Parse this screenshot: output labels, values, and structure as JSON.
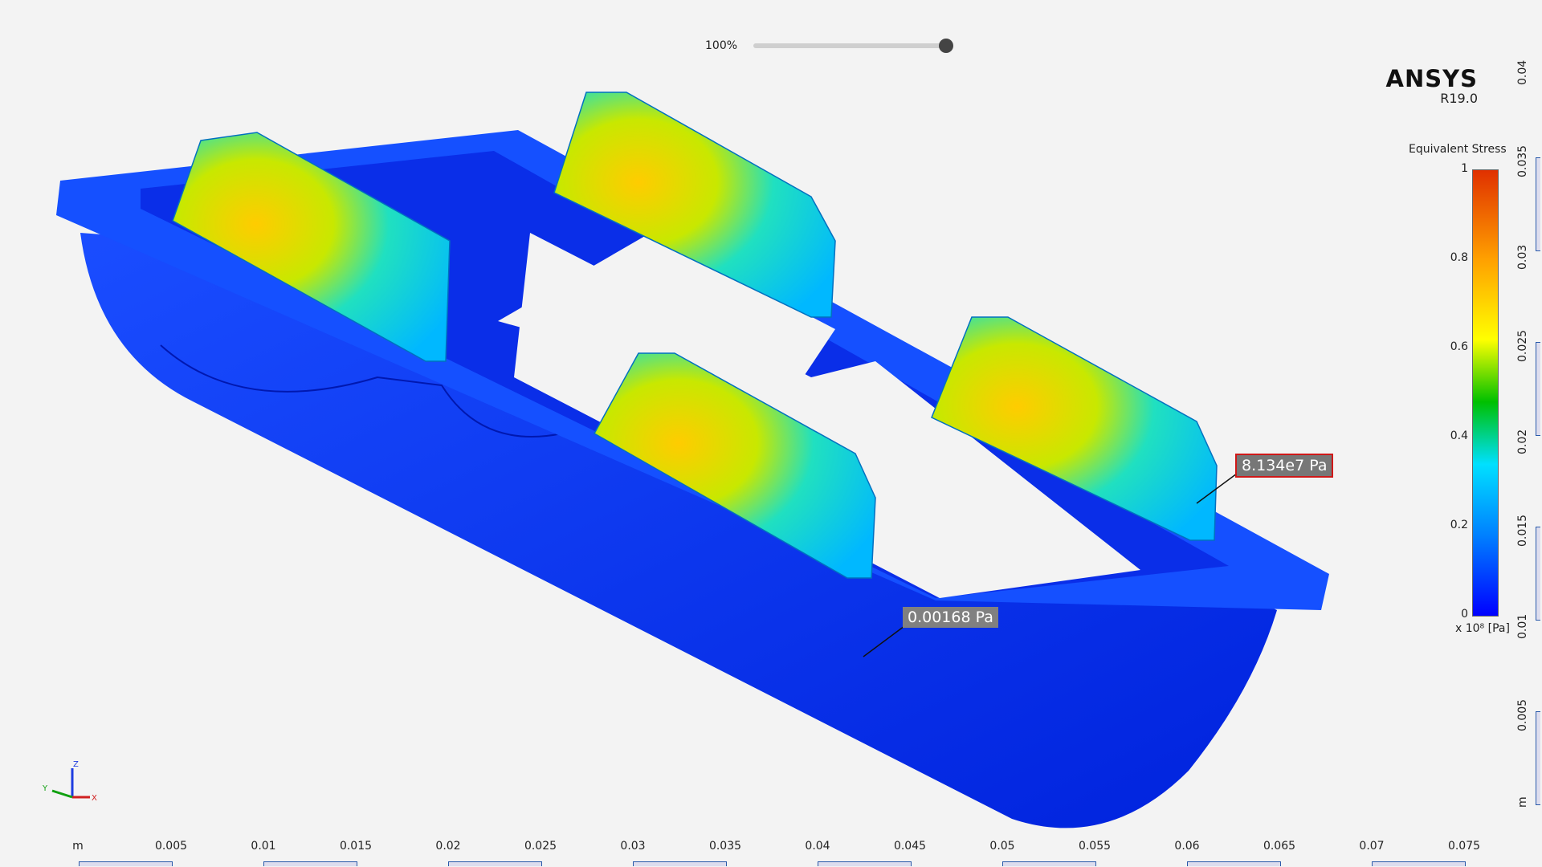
{
  "zoom": {
    "label": "100%",
    "value_percent": 100
  },
  "logo": {
    "brand": "ANSYS",
    "version": "R19.0"
  },
  "legend": {
    "title": "Equivalent Stress",
    "ticks": [
      "1",
      "0.8",
      "0.6",
      "0.4",
      "0.2",
      "0"
    ],
    "unit": "x 10⁸ [Pa]"
  },
  "probes": {
    "max": "8.134e7 Pa",
    "min": "0.00168 Pa"
  },
  "ruler_x": {
    "unit": "m",
    "ticks": [
      "0.005",
      "0.01",
      "0.015",
      "0.02",
      "0.025",
      "0.03",
      "0.035",
      "0.04",
      "0.045",
      "0.05",
      "0.055",
      "0.06",
      "0.065",
      "0.07",
      "0.075"
    ]
  },
  "ruler_y": {
    "unit": "m",
    "ticks": [
      "0.04",
      "0.035",
      "0.03",
      "0.025",
      "0.02",
      "0.015",
      "0.01",
      "0.005"
    ]
  },
  "triad": {
    "x": "X",
    "y": "Y",
    "z": "Z"
  }
}
